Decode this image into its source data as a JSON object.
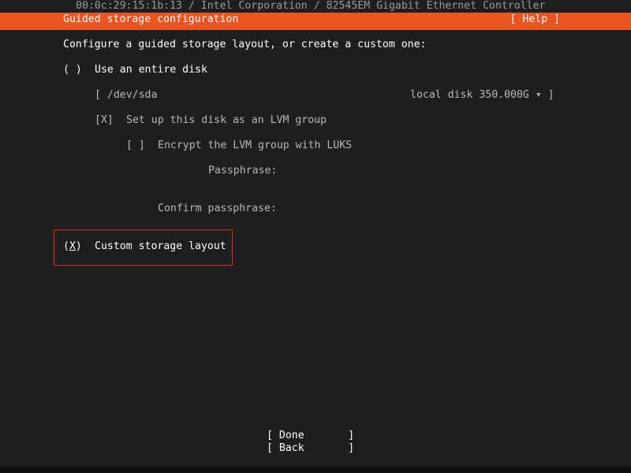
{
  "top_info": "00:0c:29:15:1b:13 / Intel Corporation / 82545EM Gigabit Ethernet Controller",
  "header": {
    "title": "Guided storage configuration",
    "help_label": "[ Help ]"
  },
  "intro": "Configure a guided storage layout, or create a custom one:",
  "entire_disk": {
    "radio": "( )",
    "label": "Use an entire disk"
  },
  "disk_select": {
    "left": "[ /dev/sda",
    "right": "local disk 350.000G ▾ ]"
  },
  "lvm": {
    "checkbox": "[X]",
    "label": "Set up this disk as an LVM group"
  },
  "encrypt": {
    "checkbox": "[ ]",
    "label": "Encrypt the LVM group with LUKS"
  },
  "passphrase_label": "Passphrase:",
  "confirm_label": "Confirm passphrase:",
  "custom": {
    "radio_open": "(",
    "radio_mark": "X",
    "radio_close": ")",
    "label": "Custom storage layout"
  },
  "buttons": {
    "done": "[ Done       ]",
    "back": "[ Back       ]"
  },
  "colors": {
    "accent": "#e95420",
    "focus_border": "#e0282a",
    "background": "#1e1e1e"
  }
}
